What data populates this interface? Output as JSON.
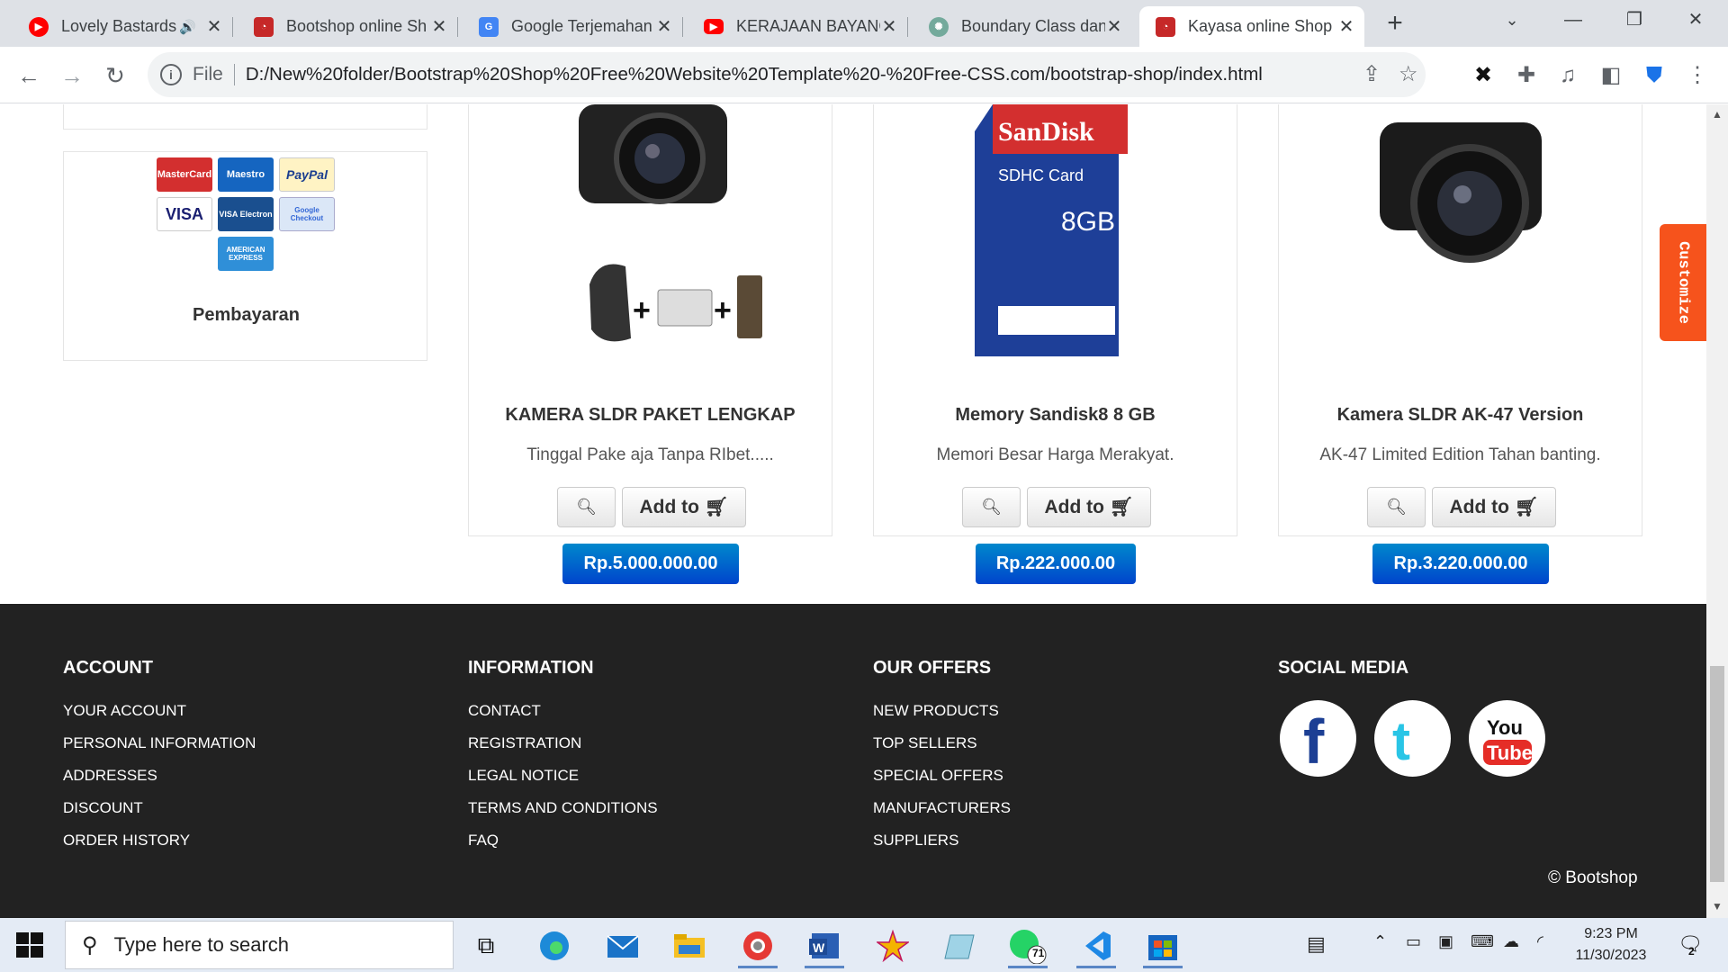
{
  "browser": {
    "tabs": [
      {
        "title": "Lovely Bastards",
        "favicon": "youtube-music-icon",
        "audio": true
      },
      {
        "title": "Bootshop online Sh",
        "favicon": "bootshop-icon"
      },
      {
        "title": "Google Terjemahan",
        "favicon": "google-translate-icon"
      },
      {
        "title": "KERAJAAN BAYANG",
        "favicon": "youtube-icon"
      },
      {
        "title": "Boundary Class dan",
        "favicon": "chatgpt-icon"
      },
      {
        "title": "Kayasa online Shop",
        "favicon": "bootshop-icon",
        "active": true
      }
    ],
    "scheme_label": "File",
    "url": "D:/New%20folder/Bootstrap%20Shop%20Free%20Website%20Template%20-%20Free-CSS.com/bootstrap-shop/index.html"
  },
  "payment": {
    "title": "Pembayaran",
    "logos": [
      "MasterCard",
      "Maestro",
      "PayPal",
      "VISA",
      "VISA Electron",
      "Google Checkout",
      "AMERICAN EXPRESS"
    ]
  },
  "products": [
    {
      "name": "KAMERA SLDR PAKET LENGKAP",
      "desc": "Tinggal Pake aja Tanpa RIbet.....",
      "add_label": "Add to",
      "price": "Rp.5.000.000.00"
    },
    {
      "name": "Memory Sandisk8 8 GB",
      "desc": "Memori Besar Harga Merakyat.",
      "add_label": "Add to",
      "price": "Rp.222.000.00"
    },
    {
      "name": "Kamera SLDR AK-47 Version",
      "desc": "AK-47 Limited Edition Tahan banting.",
      "add_label": "Add to",
      "price": "Rp.3.220.000.00"
    }
  ],
  "sandisk_label": {
    "brand": "SanDisk",
    "type": "SDHC Card",
    "capacity": "8GB"
  },
  "customize_label": "Customize",
  "footer": {
    "account": {
      "title": "ACCOUNT",
      "links": [
        "YOUR ACCOUNT",
        "PERSONAL INFORMATION",
        "ADDRESSES",
        "DISCOUNT",
        "ORDER HISTORY"
      ]
    },
    "information": {
      "title": "INFORMATION",
      "links": [
        "CONTACT",
        "REGISTRATION",
        "LEGAL NOTICE",
        "TERMS AND CONDITIONS",
        "FAQ"
      ]
    },
    "offers": {
      "title": "OUR OFFERS",
      "links": [
        "NEW PRODUCTS",
        "TOP SELLERS",
        "SPECIAL OFFERS",
        "MANUFACTURERS",
        "SUPPLIERS"
      ]
    },
    "social": {
      "title": "SOCIAL MEDIA",
      "icons": [
        "facebook-icon",
        "twitter-icon",
        "youtube-icon"
      ],
      "youtube_text": [
        "You",
        "Tube"
      ]
    },
    "copyright": "© Bootshop"
  },
  "taskbar": {
    "search_placeholder": "Type here to search",
    "whatsapp_badge": "71",
    "notification_badge": "2",
    "time": "9:23 PM",
    "date": "11/30/2023"
  },
  "colors": {
    "primary_button": "#0055cc",
    "footer_bg": "#222222",
    "customize": "#f6531c"
  }
}
